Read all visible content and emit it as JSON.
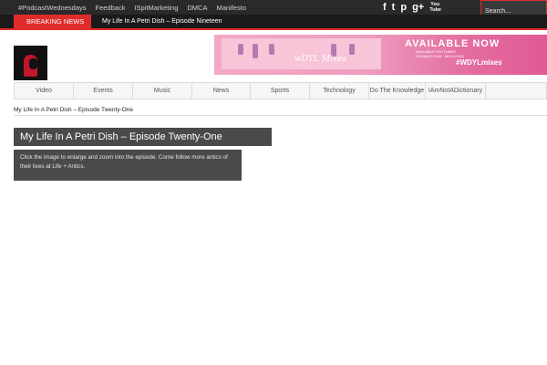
{
  "topnav": {
    "items": [
      "#PodcastWednesdays",
      "Feedback",
      "ISpitMarketing",
      "DMCA",
      "Manifesto"
    ]
  },
  "social": {
    "icons": [
      "facebook-icon",
      "twitter-icon",
      "pinterest-icon",
      "googleplus-icon",
      "youtube-icon"
    ],
    "facebook": "f",
    "twitter": "t",
    "pinterest": "p",
    "googleplus": "g+",
    "youtube": "You Tube"
  },
  "search": {
    "placeholder": "Search..."
  },
  "breaking": {
    "label": "BREAKING NEWS",
    "headline": "My Life In A Petri Dish – Episode Nineteen"
  },
  "banner": {
    "card_text": "wDYL Mixes",
    "available": "AVAILABLE NOW",
    "lines": [
      "AVAILABLE ON ITUNES",
      "SOUNDCLOUD · MIXCLOUD",
      "#WDYLMIXES"
    ],
    "hashtag": "#WDYLmixes"
  },
  "mainnav": {
    "items": [
      "Video",
      "Events",
      "Music",
      "News",
      "Sports",
      "Technology",
      "Do The Knowledge",
      "IAmNotADictionary"
    ]
  },
  "breadcrumb": "My Life In A Petri Dish – Episode Twenty-One",
  "post": {
    "title": "My Life In A Petri Dish – Episode Twenty-One",
    "description": "Click the image to enlarge and zoom into the episode. Come follow more antics of their lives at Life + Antics."
  },
  "colors": {
    "accent": "#e02b2b",
    "topbar": "#2a2a2a",
    "panel": "#4a4a4a"
  }
}
